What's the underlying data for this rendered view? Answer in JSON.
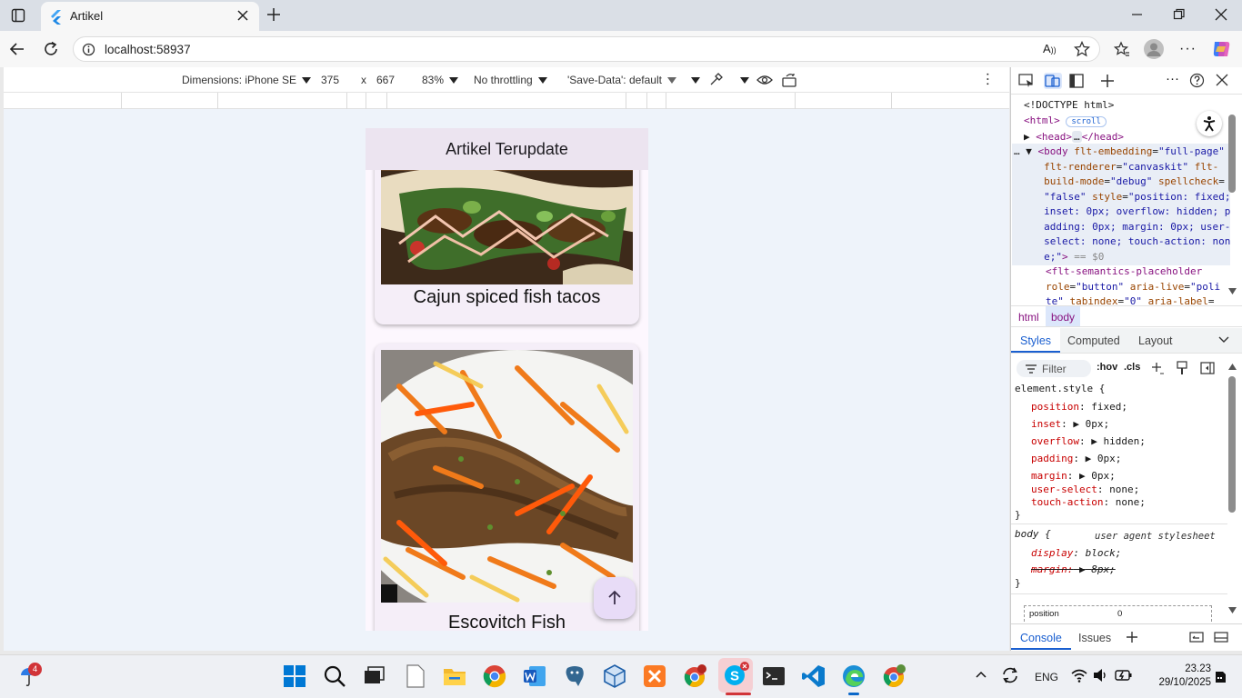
{
  "browser": {
    "tab_title": "Artikel",
    "url": "localhost:58937"
  },
  "device_toolbar": {
    "dimensions_label": "Dimensions: iPhone SE",
    "width": "375",
    "times": "x",
    "height": "667",
    "zoom": "83%",
    "throttling": "No throttling",
    "save_data": "'Save-Data': default"
  },
  "app": {
    "appbar_title": "Artikel Terupdate",
    "articles": [
      {
        "title": "Cajun spiced fish tacos"
      },
      {
        "title": "Escovitch Fish"
      }
    ]
  },
  "devtools": {
    "elements": {
      "doctype": "<!DOCTYPE html>",
      "html_tag": "<html>",
      "scroll_badge": "scroll",
      "head_open": "<head>",
      "head_close": "</head>",
      "ellipsis": "…",
      "selected_marker": "== $0"
    },
    "breadcrumbs": [
      "html",
      "body"
    ],
    "subtabs": [
      "Styles",
      "Computed",
      "Layout"
    ],
    "filter_placeholder": "Filter",
    "hov": ":hov",
    "cls": ".cls",
    "styles": {
      "selector": "element.style {",
      "rules": [
        {
          "prop": "position",
          "value": "fixed;"
        },
        {
          "prop": "inset",
          "value": "0px;"
        },
        {
          "prop": "overflow",
          "value": "hidden;"
        },
        {
          "prop": "padding",
          "value": "0px;"
        },
        {
          "prop": "margin",
          "value": "0px;"
        },
        {
          "prop": "user-select",
          "value": "none;"
        },
        {
          "prop": "touch-action",
          "value": "none;"
        }
      ],
      "close": "}",
      "body_selector": "body {",
      "ua_label": "user agent stylesheet",
      "body_rules": [
        {
          "prop": "display",
          "value": "block;"
        },
        {
          "prop": "margin:",
          "value": "8px;"
        }
      ],
      "box_position_label": "position",
      "box_position_value": "0"
    },
    "drawer_tabs": [
      "Console",
      "Issues"
    ]
  },
  "taskbar": {
    "weather_badge": "4",
    "language": "ENG",
    "time": "23.23",
    "date": "29/10/2025"
  }
}
